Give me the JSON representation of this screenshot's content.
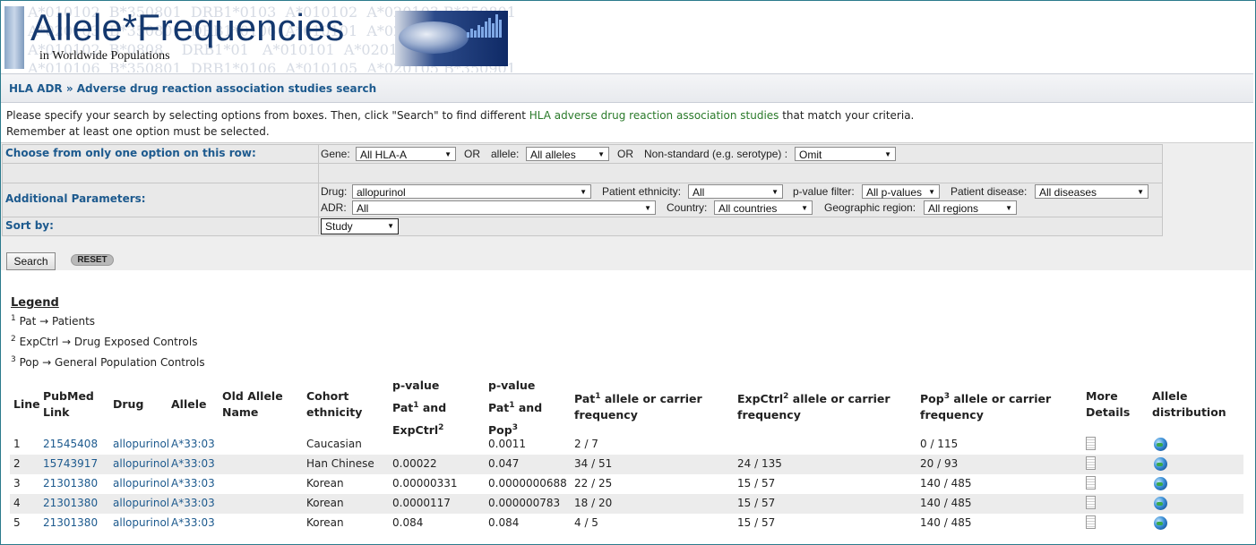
{
  "header": {
    "logo_title": "Allele*Frequencies",
    "logo_subtitle": "in Worldwide Populations",
    "bg_text": "A*010102  B*350801  DRB1*0103  A*010102  A*020103 B*350801\nA*020103  B*350801  DRB1*0106  A*010101  A*020101 B*3\nA*010102  B*0808    DRB1*01   A*010101  A*020104 B*3\nA*010106  B*350801  DRB1*0106  A*010105  A*020105 B*350901"
  },
  "breadcrumb": "HLA ADR » Adverse drug reaction association studies search",
  "intro": {
    "line1_pre": "Please specify your search by selecting options from boxes. Then, click \"Search\" to find different ",
    "line1_link": "HLA adverse drug reaction association studies",
    "line1_post": " that match your criteria.",
    "line2": "Remember at least one option must be selected."
  },
  "form": {
    "row1_label": "Choose from only one option on this row:",
    "gene_label": "Gene:",
    "gene_value": "All HLA-A",
    "or1": "OR",
    "allele_label": "allele:",
    "allele_value": "All alleles",
    "or2": "OR",
    "nonstd_label": "Non-standard (e.g. serotype) :",
    "nonstd_value": "Omit",
    "additional_label": "Additional Parameters:",
    "drug_label": "Drug:",
    "drug_value": "allopurinol",
    "ethnicity_label": "Patient ethnicity:",
    "ethnicity_value": "All",
    "pvalue_label": "p-value filter:",
    "pvalue_value": "All p-values",
    "disease_label": "Patient disease:",
    "disease_value": "All diseases",
    "adr_label": "ADR:",
    "adr_value": "All",
    "country_label": "Country:",
    "country_value": "All countries",
    "region_label": "Geographic region:",
    "region_value": "All regions",
    "sort_label": "Sort by:",
    "sort_value": "Study",
    "search_button": "Search",
    "reset_button": "RESET"
  },
  "legend": {
    "title": "Legend",
    "items": [
      {
        "num": "1",
        "text": "Pat → Patients"
      },
      {
        "num": "2",
        "text": "ExpCtrl → Drug Exposed Controls"
      },
      {
        "num": "3",
        "text": "Pop → General Population Controls"
      }
    ]
  },
  "table": {
    "headers": {
      "line": "Line",
      "pubmed1": "PubMed",
      "pubmed2": "Link",
      "drug": "Drug",
      "allele": "Allele",
      "old1": "Old Allele",
      "old2": "Name",
      "cohort1": "Cohort",
      "cohort2": "ethnicity",
      "pv1_1": "p-value",
      "pv1_2a": "Pat",
      "pv1_2s": "1",
      "pv1_2b": " and",
      "pv1_3a": "ExpCtrl",
      "pv1_3s": "2",
      "pv2_1": "p-value",
      "pv2_2a": "Pat",
      "pv2_2s": "1",
      "pv2_2b": " and",
      "pv2_3a": "Pop",
      "pv2_3s": "3",
      "patf_a": "Pat",
      "patf_s": "1",
      "patf_b": " allele or carrier",
      "patf_2": "frequency",
      "expf_a": "ExpCtrl",
      "expf_s": "2",
      "expf_b": " allele or carrier",
      "expf_2": "frequency",
      "popf_a": "Pop",
      "popf_s": "3",
      "popf_b": " allele or carrier",
      "popf_2": "frequency",
      "more1": "More",
      "more2": "Details",
      "dist1": "Allele",
      "dist2": "distribution"
    },
    "rows": [
      {
        "line": "1",
        "pubmed": "21545408",
        "drug": "allopurinol",
        "allele": "A*33:03",
        "old": "",
        "cohort": "Caucasian",
        "pv1": "",
        "pv2": "0.0011",
        "pat": "2 / 7",
        "exp": "",
        "pop": "0 / 115"
      },
      {
        "line": "2",
        "pubmed": "15743917",
        "drug": "allopurinol",
        "allele": "A*33:03",
        "old": "",
        "cohort": "Han Chinese",
        "pv1": "0.00022",
        "pv2": "0.047",
        "pat": "34 / 51",
        "exp": "24 / 135",
        "pop": "20 / 93"
      },
      {
        "line": "3",
        "pubmed": "21301380",
        "drug": "allopurinol",
        "allele": "A*33:03",
        "old": "",
        "cohort": "Korean",
        "pv1": "0.00000331",
        "pv2": "0.0000000688",
        "pat": "22 / 25",
        "exp": "15 / 57",
        "pop": "140 / 485"
      },
      {
        "line": "4",
        "pubmed": "21301380",
        "drug": "allopurinol",
        "allele": "A*33:03",
        "old": "",
        "cohort": "Korean",
        "pv1": "0.0000117",
        "pv2": "0.000000783",
        "pat": "18 / 20",
        "exp": "15 / 57",
        "pop": "140 / 485"
      },
      {
        "line": "5",
        "pubmed": "21301380",
        "drug": "allopurinol",
        "allele": "A*33:03",
        "old": "",
        "cohort": "Korean",
        "pv1": "0.084",
        "pv2": "0.084",
        "pat": "4 / 5",
        "exp": "15 / 57",
        "pop": "140 / 485"
      }
    ]
  }
}
